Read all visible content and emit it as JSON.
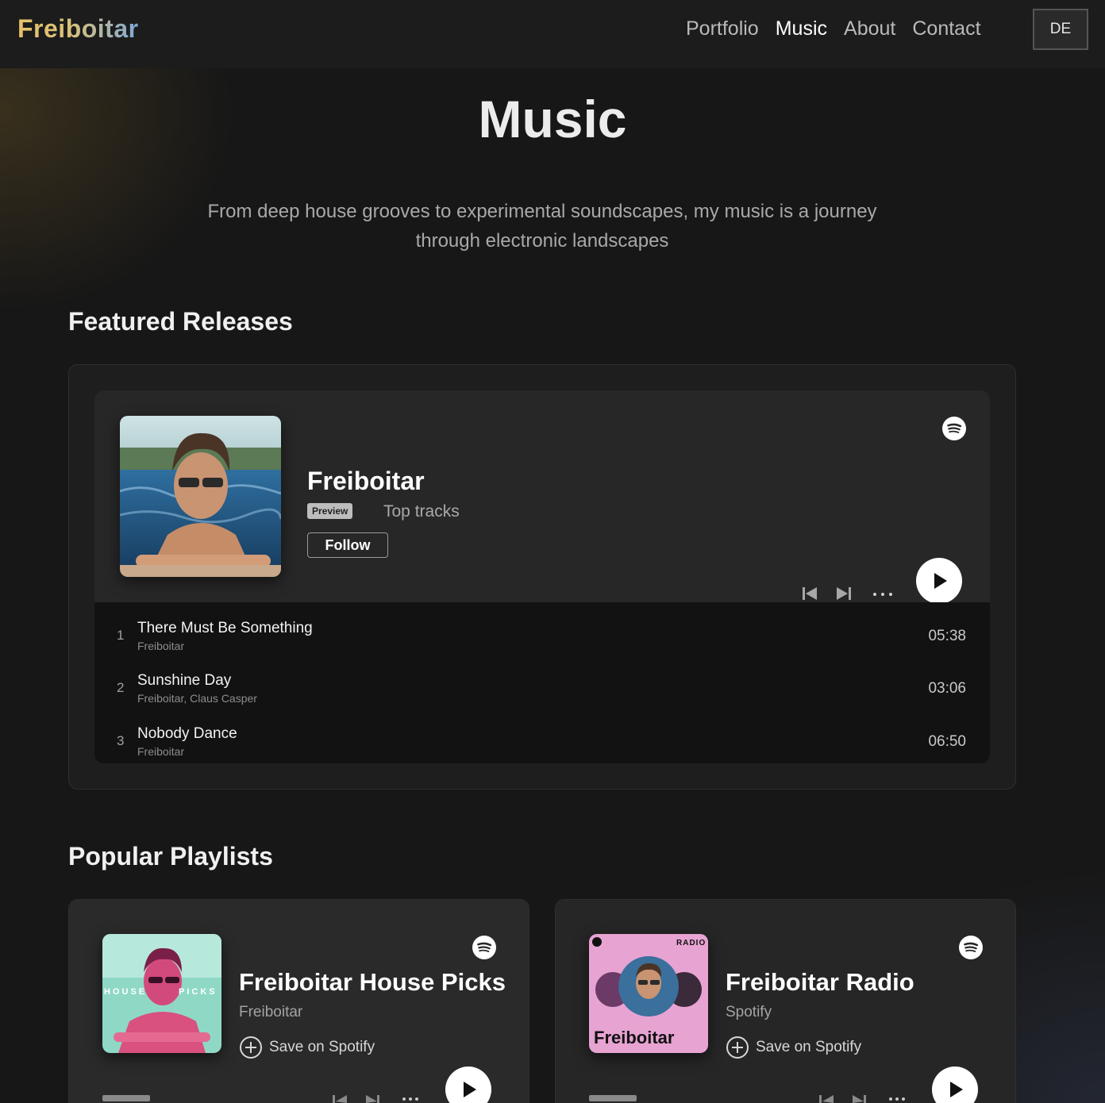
{
  "header": {
    "logo": "Freiboitar",
    "nav": [
      {
        "label": "Portfolio",
        "active": false
      },
      {
        "label": "Music",
        "active": true
      },
      {
        "label": "About",
        "active": false
      },
      {
        "label": "Contact",
        "active": false
      }
    ],
    "lang_button": "DE"
  },
  "hero": {
    "title": "Music",
    "intro": "From deep house grooves to experimental soundscapes, my music is a journey through electronic landscapes"
  },
  "featured": {
    "section_title": "Featured Releases",
    "embed": {
      "title": "Freiboitar",
      "badge": "Preview",
      "subtitle": "Top tracks",
      "follow_label": "Follow",
      "tracks": [
        {
          "num": "1",
          "name": "There Must Be Something",
          "artist": "Freiboitar",
          "duration": "05:38"
        },
        {
          "num": "2",
          "name": "Sunshine Day",
          "artist": "Freiboitar, Claus Casper",
          "duration": "03:06"
        },
        {
          "num": "3",
          "name": "Nobody Dance",
          "artist": "Freiboitar",
          "duration": "06:50"
        }
      ]
    }
  },
  "playlists": {
    "section_title": "Popular Playlists",
    "items": [
      {
        "title": "Freiboitar House Picks",
        "owner": "Freiboitar",
        "save_label": "Save on Spotify",
        "cover_text_left": "HOUSE",
        "cover_text_right": "PICKS",
        "accent": "#7fd0c0"
      },
      {
        "title": "Freiboitar Radio",
        "owner": "Spotify",
        "save_label": "Save on Spotify",
        "cover_tag": "RADIO",
        "cover_name": "Freiboitar",
        "accent": "#e7a3d2"
      }
    ]
  },
  "icons": {
    "spotify": "spotify-icon",
    "prev": "skip-back-icon",
    "next": "skip-forward-icon",
    "more": "more-icon",
    "play": "play-icon",
    "add": "plus-circle-icon"
  },
  "colors": {
    "background": "#171717",
    "card": "#1e1e1e",
    "embed": "#272727",
    "tracklist": "#121212"
  }
}
